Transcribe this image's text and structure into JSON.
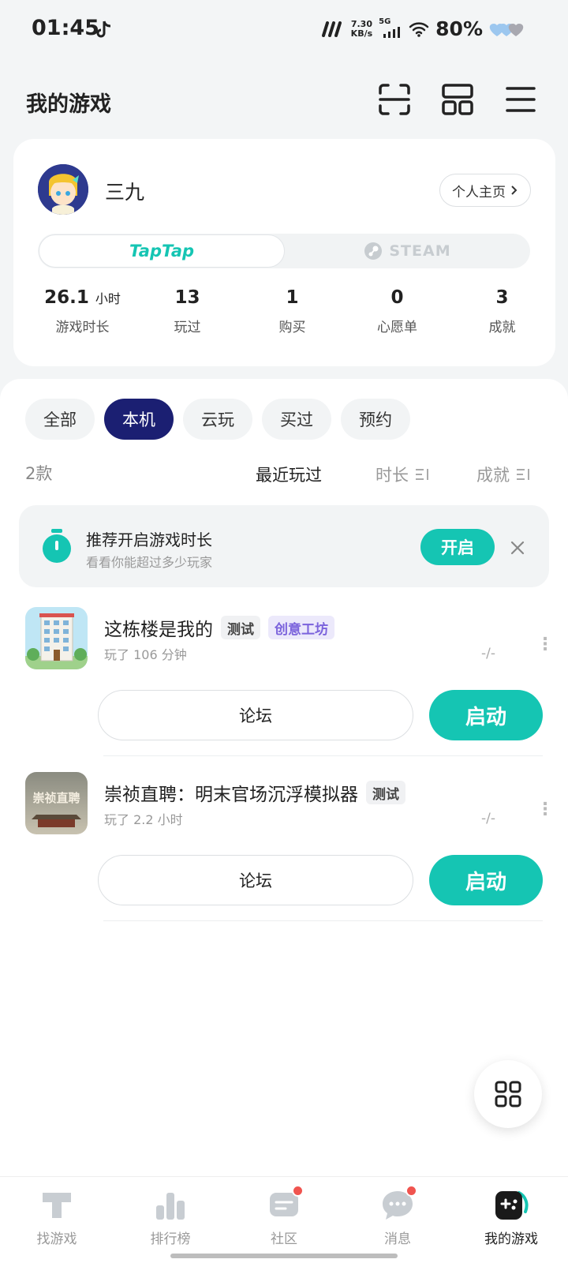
{
  "status_bar": {
    "time": "01:45",
    "net_speed_top": "7.30",
    "net_speed_bottom": "KB/s",
    "signal": "5G",
    "battery": "80%"
  },
  "header": {
    "title": "我的游戏"
  },
  "profile": {
    "name": "三九",
    "home_button": "个人主页"
  },
  "platforms": {
    "taptap": "TapTap",
    "steam": "STEAM"
  },
  "stats": [
    {
      "value": "26.1",
      "unit": "小时",
      "label": "游戏时长"
    },
    {
      "value": "13",
      "unit": "",
      "label": "玩过"
    },
    {
      "value": "1",
      "unit": "",
      "label": "购买"
    },
    {
      "value": "0",
      "unit": "",
      "label": "心愿单"
    },
    {
      "value": "3",
      "unit": "",
      "label": "成就"
    }
  ],
  "filters": {
    "chips": [
      "全部",
      "本机",
      "云玩",
      "买过",
      "预约"
    ],
    "active": "本机"
  },
  "list_header": {
    "count": "2款",
    "sort_recent": "最近玩过",
    "sort_duration": "时长",
    "sort_achievement": "成就"
  },
  "banner": {
    "title": "推荐开启游戏时长",
    "subtitle": "看看你能超过多少玩家",
    "button": "开启"
  },
  "games": [
    {
      "title": "这栋楼是我的",
      "tags": [
        "测试",
        "创意工坊"
      ],
      "played": "玩了 106 分钟",
      "meta": "-/-",
      "forum": "论坛",
      "launch": "启动"
    },
    {
      "title": "崇祯直聘：明末官场沉浮模拟器",
      "tags": [
        "测试"
      ],
      "played": "玩了 2.2 小时",
      "meta": "-/-",
      "forum": "论坛",
      "launch": "启动",
      "icon_text": "崇祯直聘"
    }
  ],
  "nav": [
    {
      "label": "找游戏"
    },
    {
      "label": "排行榜"
    },
    {
      "label": "社区"
    },
    {
      "label": "消息"
    },
    {
      "label": "我的游戏"
    }
  ],
  "colors": {
    "accent": "#15c5b3",
    "active_chip": "#1b1f72",
    "badge": "#f0544f",
    "workshop_tag": "#7b63dc"
  }
}
